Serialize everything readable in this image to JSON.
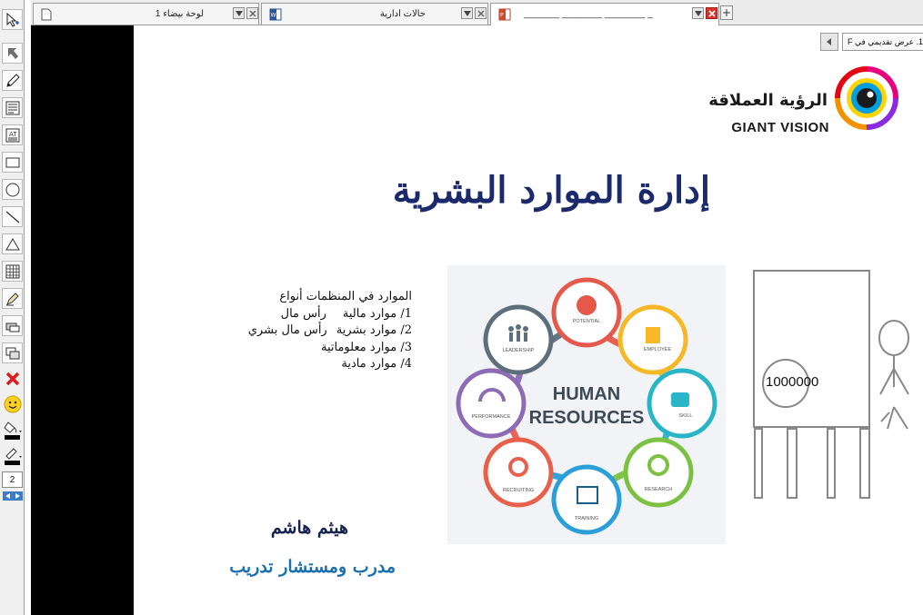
{
  "toolbar": {
    "page_number": "2"
  },
  "tabs": [
    {
      "title": "لوحة بيضاء 1"
    },
    {
      "title": "حالات ادارية"
    },
    {
      "title": "_______ ________ ________ _"
    }
  ],
  "slide_nav": {
    "label": "1. عرض تقديمي في F"
  },
  "logo": {
    "arabic": "الرؤية العملاقة",
    "english": "GIANT VISION"
  },
  "slide": {
    "title": "إدارة الموارد البشرية",
    "types_heading": "الموارد في المنظمات أنواع",
    "types": [
      {
        "number": "1/",
        "name": "موارد مالية",
        "note": "رأس مال"
      },
      {
        "number": "2/",
        "name": "موارد بشرية",
        "note": "رأس مال بشري"
      },
      {
        "number": "3/",
        "name": "موارد معلوماتية",
        "note": ""
      },
      {
        "number": "4/",
        "name": "موارد مادية",
        "note": ""
      }
    ],
    "author_name": "هيثم هاشم",
    "author_role": "مدرب ومستشار تدريب"
  },
  "hr_graphic": {
    "center_line1": "HUMAN",
    "center_line2": "RESOURCES",
    "nodes": [
      "POTENTIAL",
      "EMPLOYEE",
      "SKILL",
      "RESEARCH",
      "TRAINING",
      "RECRUITING",
      "PERFORMANCE",
      "LEADERSHIP"
    ]
  },
  "whiteboard": {
    "number": "1000000"
  },
  "colors": {
    "title": "#1b2a6b",
    "author_role": "#1a6fb0",
    "node_red": "#e5594b",
    "node_yellow": "#f6b826",
    "node_teal": "#28b5c7",
    "node_green": "#7cc142",
    "node_blue": "#2b9fd9",
    "node_coral": "#e8604c",
    "node_purple": "#8e6bb5",
    "node_slate": "#5d6f7d"
  }
}
